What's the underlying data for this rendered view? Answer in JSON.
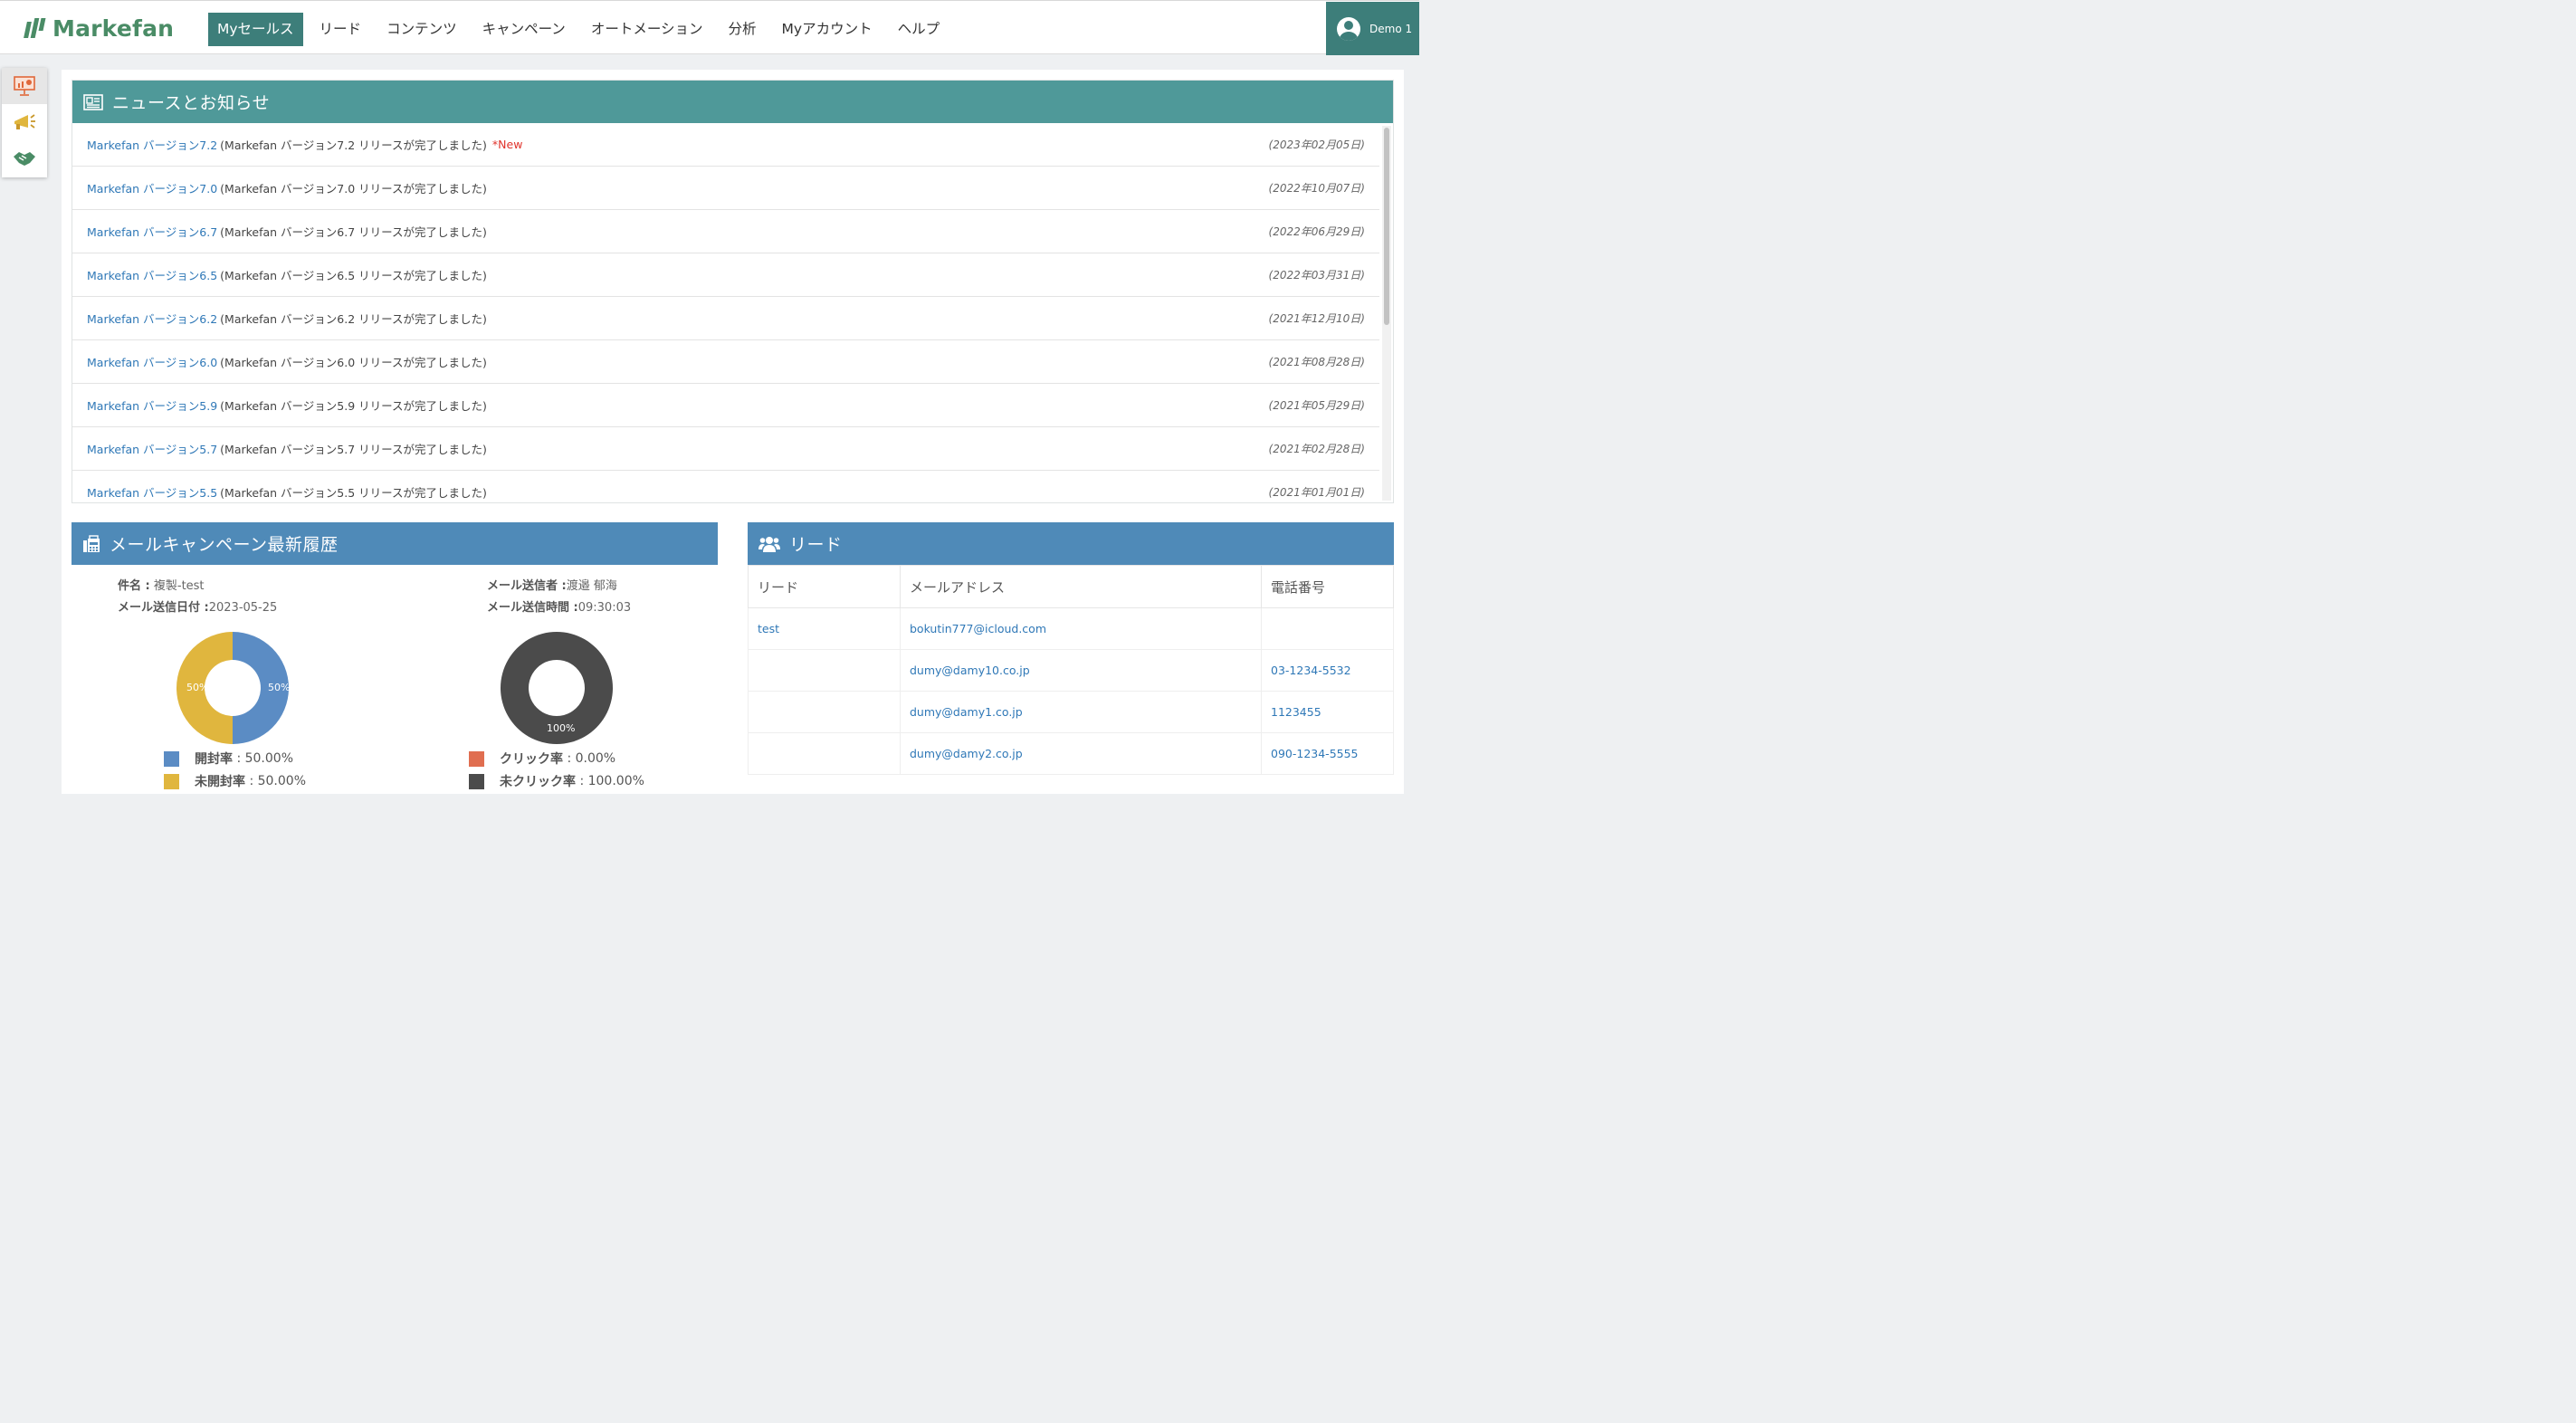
{
  "header": {
    "brand": "Markefan",
    "nav": [
      {
        "label": "Myセールス",
        "active": true
      },
      {
        "label": "リード",
        "active": false
      },
      {
        "label": "コンテンツ",
        "active": false
      },
      {
        "label": "キャンペーン",
        "active": false
      },
      {
        "label": "オートメーション",
        "active": false
      },
      {
        "label": "分析",
        "active": false
      },
      {
        "label": "Myアカウント",
        "active": false
      },
      {
        "label": "ヘルプ",
        "active": false
      }
    ],
    "user": "Demo 1"
  },
  "colors": {
    "brand_green": "#4a8c66",
    "nav_active": "#3d7e7a",
    "news_header": "#4f9999",
    "panel_header": "#4f8ab8",
    "link": "#2f78b7",
    "new_badge": "#e0342c",
    "open": "#5b8cc4",
    "unopened": "#e0b63e",
    "click": "#e06e50",
    "no_click": "#4b4b4b"
  },
  "news": {
    "title": "ニュースとお知らせ",
    "items": [
      {
        "link": "Markefan バージョン7.2",
        "desc": "(Markefan バージョン7.2 リリースが完了しました)",
        "badge": "*New",
        "date": "(2023年02月05日)"
      },
      {
        "link": "Markefan バージョン7.0",
        "desc": "(Markefan バージョン7.0 リリースが完了しました)",
        "badge": "",
        "date": "(2022年10月07日)"
      },
      {
        "link": "Markefan バージョン6.7",
        "desc": "(Markefan バージョン6.7 リリースが完了しました)",
        "badge": "",
        "date": "(2022年06月29日)"
      },
      {
        "link": "Markefan バージョン6.5",
        "desc": "(Markefan バージョン6.5 リリースが完了しました)",
        "badge": "",
        "date": "(2022年03月31日)"
      },
      {
        "link": "Markefan バージョン6.2",
        "desc": "(Markefan バージョン6.2 リリースが完了しました)",
        "badge": "",
        "date": "(2021年12月10日)"
      },
      {
        "link": "Markefan バージョン6.0",
        "desc": "(Markefan バージョン6.0 リリースが完了しました)",
        "badge": "",
        "date": "(2021年08月28日)"
      },
      {
        "link": "Markefan バージョン5.9",
        "desc": "(Markefan バージョン5.9 リリースが完了しました)",
        "badge": "",
        "date": "(2021年05月29日)"
      },
      {
        "link": "Markefan バージョン5.7",
        "desc": "(Markefan バージョン5.7 リリースが完了しました)",
        "badge": "",
        "date": "(2021年02月28日)"
      },
      {
        "link": "Markefan バージョン5.5",
        "desc": "(Markefan バージョン5.5 リリースが完了しました)",
        "badge": "",
        "date": "(2021年01月01日)"
      }
    ]
  },
  "mail": {
    "title": "メールキャンペーン最新履歴",
    "subject_label": "件名 :",
    "subject": "複製-test",
    "date_label": "メール送信日付 :",
    "date": "2023-05-25",
    "sender_label": "メール送信者 :",
    "sender": "渡邉 郁海",
    "time_label": "メール送信時間 :",
    "time": "09:30:03",
    "open_chart": {
      "type": "pie",
      "slices": [
        {
          "label": "開封率",
          "value": 50,
          "text": "50%"
        },
        {
          "label": "未開封率",
          "value": 50,
          "text": "50%"
        }
      ]
    },
    "click_chart": {
      "type": "pie",
      "slices": [
        {
          "label": "クリック率",
          "value": 0
        },
        {
          "label": "未クリック率",
          "value": 100,
          "text": "100%"
        }
      ]
    },
    "legend": {
      "open_label": "開封率",
      "open_value": ": 50.00%",
      "unopened_label": "未開封率",
      "unopened_value": ": 50.00%",
      "click_label": "クリック率",
      "click_value": ": 0.00%",
      "noclick_label": "未クリック率",
      "noclick_value": ": 100.00%"
    }
  },
  "leads": {
    "title": "リード",
    "columns": [
      "リード",
      "メールアドレス",
      "電話番号"
    ],
    "rows": [
      [
        "test",
        "bokutin777@icloud.com",
        ""
      ],
      [
        "",
        "dumy@damy10.co.jp",
        "03-1234-5532"
      ],
      [
        "",
        "dumy@damy1.co.jp",
        "1123455"
      ],
      [
        "",
        "dumy@damy2.co.jp",
        "090-1234-5555"
      ]
    ]
  }
}
